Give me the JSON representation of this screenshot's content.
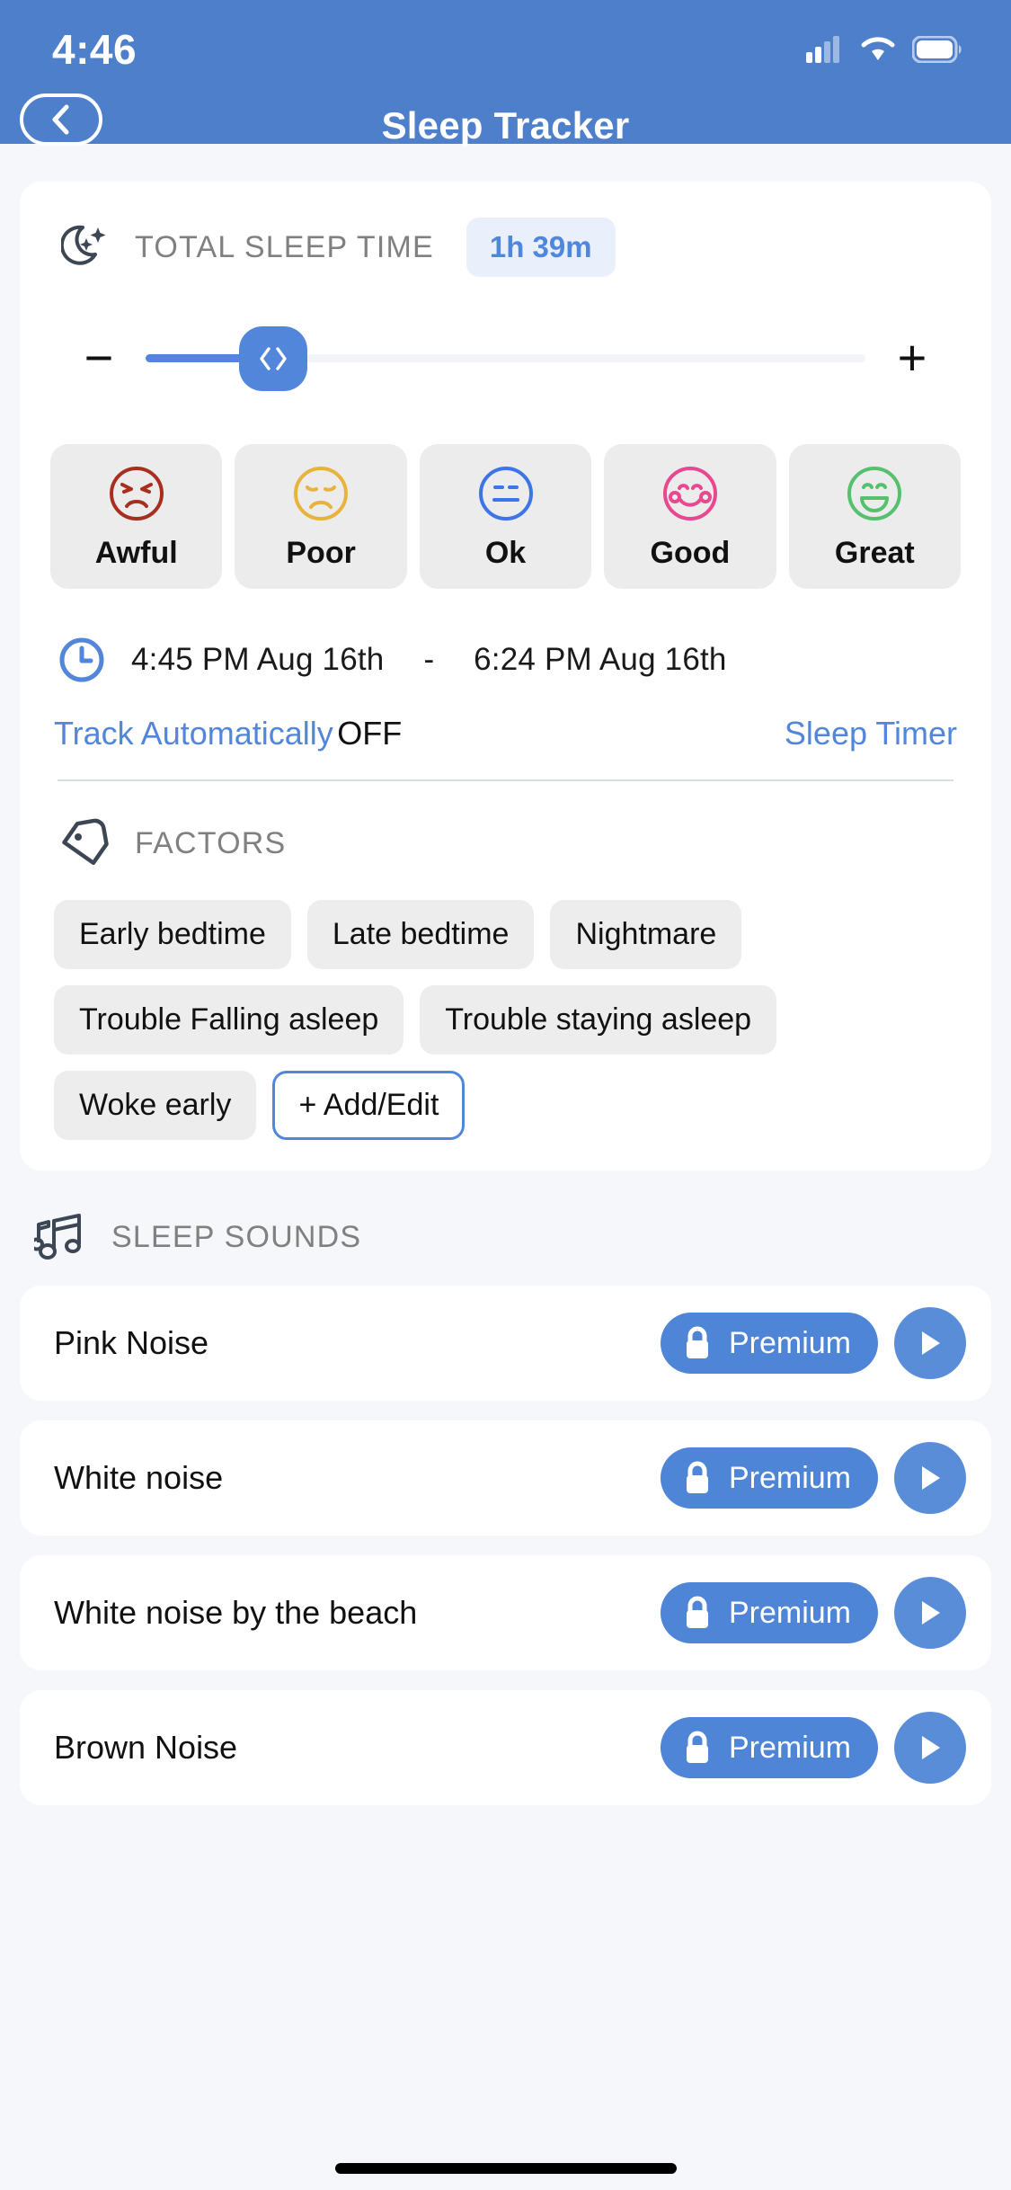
{
  "status_bar": {
    "time": "4:46",
    "cellular_icon": "cellular-signal-icon",
    "wifi_icon": "wifi-icon",
    "battery_icon": "battery-icon"
  },
  "header": {
    "title": "Sleep Tracker",
    "back_icon": "chevron-left-icon",
    "background_color": "#4e7fcb"
  },
  "total_sleep": {
    "icon": "moon-stars-icon",
    "label": "TOTAL SLEEP TIME",
    "duration": "1h 39m",
    "badge_color": "#4e87dd"
  },
  "slider": {
    "decrease_label": "−",
    "increase_label": "+",
    "thumb_icon": "left-right-chevrons-icon",
    "fill_percent": 20,
    "accent_color": "#5286da"
  },
  "moods": [
    {
      "label": "Awful",
      "icon": "angry-face-icon",
      "color": "#a82f1f"
    },
    {
      "label": "Poor",
      "icon": "sad-face-icon",
      "color": "#e8b33c"
    },
    {
      "label": "Ok",
      "icon": "neutral-face-icon",
      "color": "#3d74e8"
    },
    {
      "label": "Good",
      "icon": "happy-face-icon",
      "color": "#e8488f"
    },
    {
      "label": "Great",
      "icon": "grinning-face-icon",
      "color": "#55c16e"
    }
  ],
  "session": {
    "clock_icon": "clock-icon",
    "start_time": "4:45 PM Aug 16th",
    "separator": "-",
    "end_time": "6:24 PM Aug 16th",
    "track_automatically_label": "Track Automatically",
    "track_automatically_state": "OFF",
    "sleep_timer_label": "Sleep Timer"
  },
  "factors": {
    "icon": "tag-icon",
    "label": "FACTORS",
    "chips": [
      "Early bedtime",
      "Late bedtime",
      "Nightmare",
      "Trouble Falling asleep",
      "Trouble staying asleep",
      "Woke early"
    ],
    "add_edit_label": "+ Add/Edit"
  },
  "sleep_sounds": {
    "icon": "music-notes-icon",
    "label": "SLEEP SOUNDS",
    "premium_label": "Premium",
    "lock_icon": "lock-icon",
    "play_icon": "play-icon",
    "items": [
      {
        "name": "Pink Noise"
      },
      {
        "name": "White noise"
      },
      {
        "name": "White noise by the beach"
      },
      {
        "name": "Brown Noise"
      }
    ]
  }
}
